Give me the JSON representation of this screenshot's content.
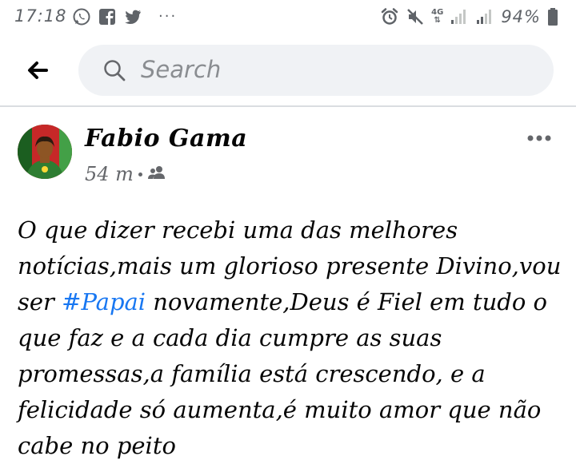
{
  "status_bar": {
    "time": "17:18",
    "more": "···",
    "network": "4G",
    "battery": "94%"
  },
  "search": {
    "placeholder": "Search"
  },
  "post": {
    "author": "Fabio Gama",
    "time": "54 m",
    "audience_icon": "friends-icon",
    "text_before": "O que dizer recebi uma das melhores notícias,mais um glorioso presente Divino,vou ser ",
    "hashtag": "#Papai",
    "text_after": " novamente,Deus é Fiel em tudo o que faz e a cada dia cumpre as suas promessas,a família está crescendo, e a felicidade só aumenta,é muito amor que não cabe no peito"
  },
  "colors": {
    "accent": "#1877f2",
    "search_bg": "#f0f2f5",
    "divider": "#dadde1",
    "secondary_text": "#65676b"
  }
}
